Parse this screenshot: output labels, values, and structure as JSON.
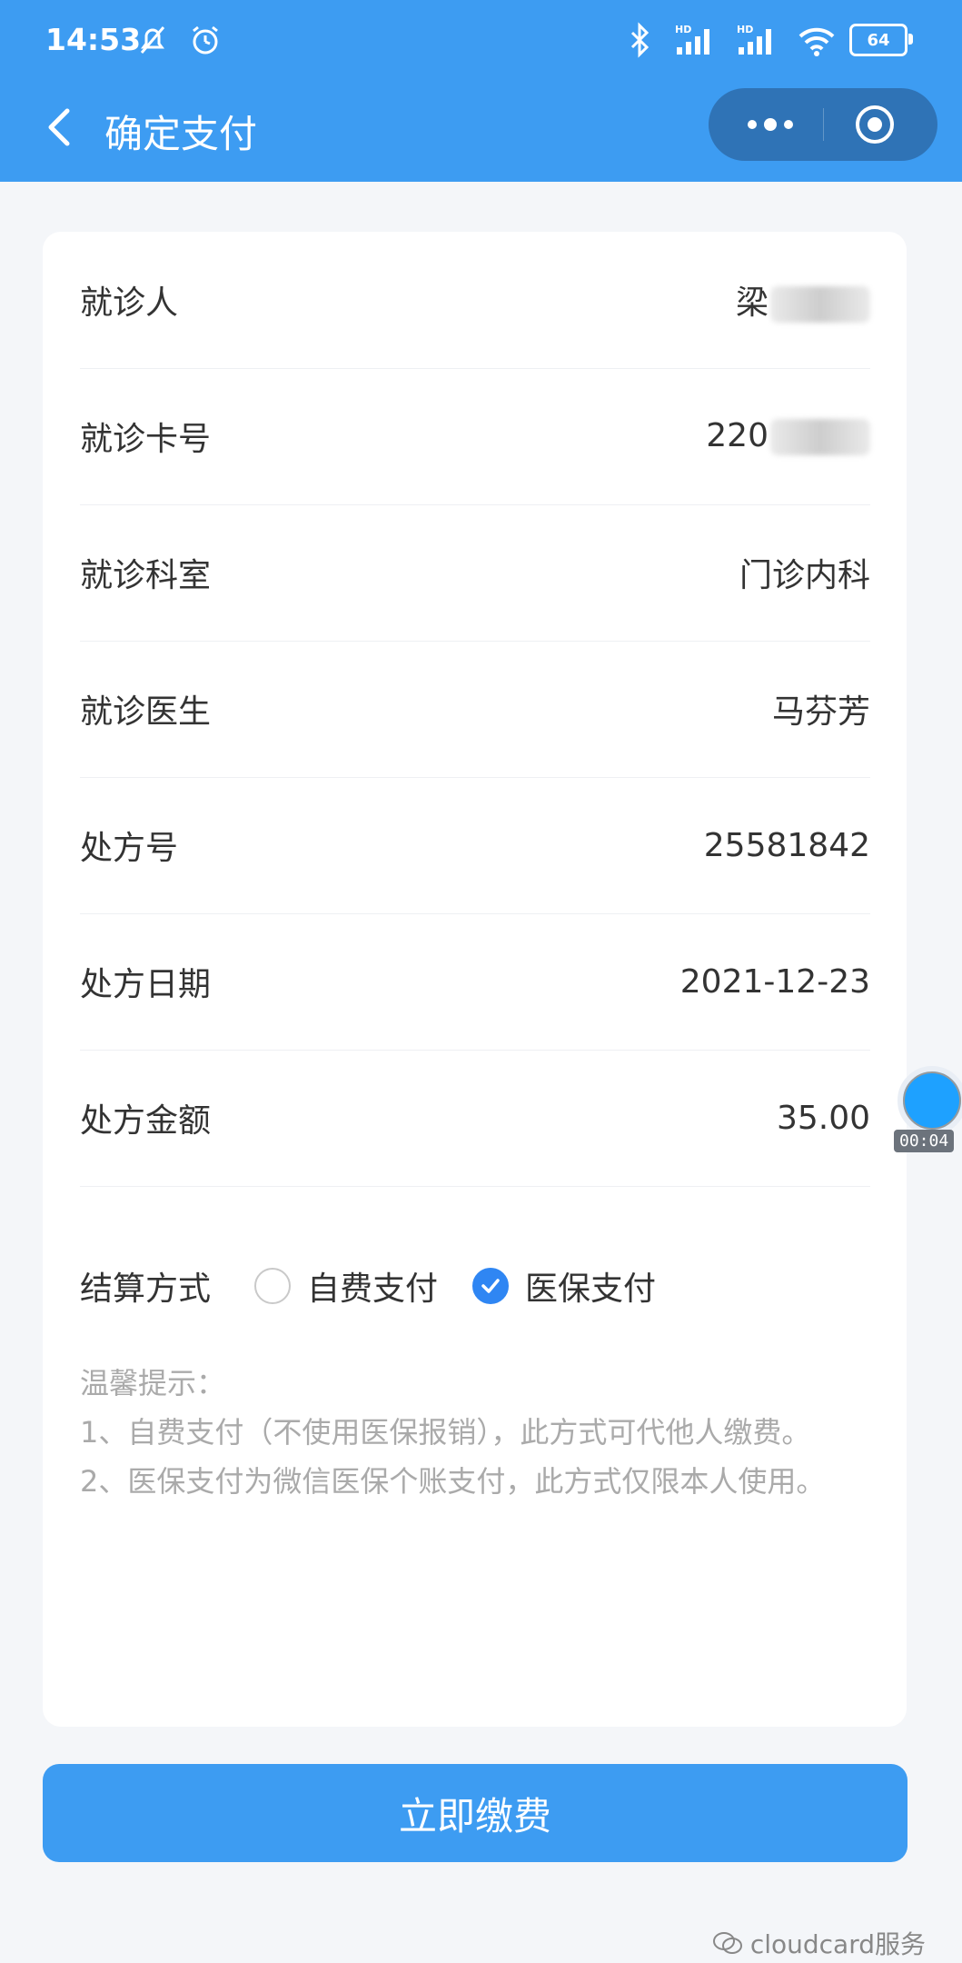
{
  "status_bar": {
    "time": "14:53",
    "battery": "64",
    "hd1": "HD",
    "hd2": "HD"
  },
  "nav": {
    "title": "确定支付"
  },
  "rows": [
    {
      "label": "就诊人",
      "value": "梁"
    },
    {
      "label": "就诊卡号",
      "value": "220"
    },
    {
      "label": "就诊科室",
      "value": "门诊内科"
    },
    {
      "label": "就诊医生",
      "value": "马芬芳"
    },
    {
      "label": "处方号",
      "value": "25581842"
    },
    {
      "label": "处方日期",
      "value": "2021-12-23"
    },
    {
      "label": "处方金额",
      "value": "35.00"
    }
  ],
  "settlement": {
    "label": "结算方式",
    "options": [
      {
        "label": "自费支付",
        "checked": false
      },
      {
        "label": "医保支付",
        "checked": true
      }
    ]
  },
  "tips": {
    "title": "温馨提示：",
    "line1": "1、自费支付（不使用医保报销），此方式可代他人缴费。",
    "line2": "2、医保支付为微信医保个账支付，此方式仅限本人使用。"
  },
  "pay_button": "立即缴费",
  "recorder_time": "00:04",
  "watermark": "cloudcard服务",
  "colors": {
    "primary": "#3d9cf2",
    "check": "#2f86f3"
  }
}
